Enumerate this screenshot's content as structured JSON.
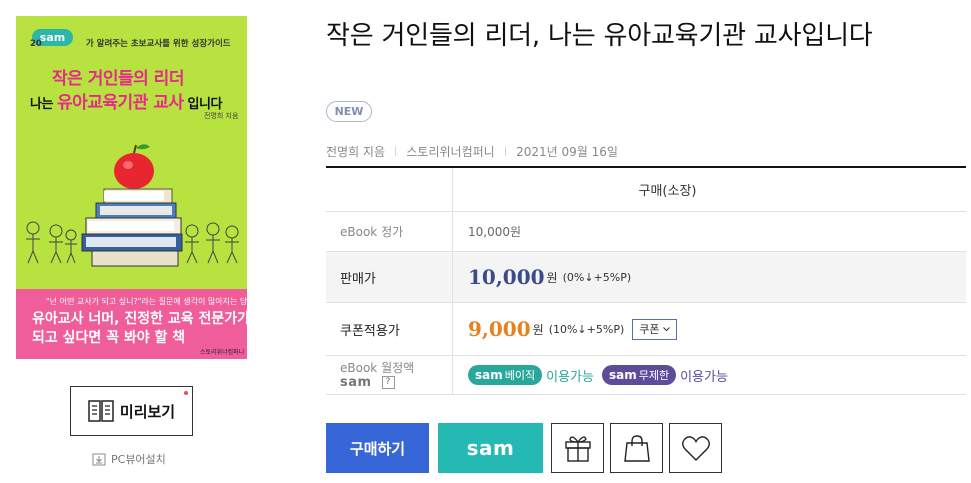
{
  "cover": {
    "sam_badge": "sam",
    "tagline": "가 알려주는 초보교사를 위한 성장가이드",
    "tagline_prefix": "20",
    "title_line1": "작은 거인들의 리더",
    "title_line2_a": "나는 ",
    "title_line2_b": "유아교육기관 교사",
    "title_line2_c": " 입니다",
    "author": "전명희 지음",
    "quote": "\"넌 어떤 교사가 되고 싶니?\"라는 질문에 생각이 많아지는 당신",
    "bottom_line1": "유아교사 너머, 진정한 교육 전문가가",
    "bottom_line2": "되고 싶다면 꼭 봐야 할 책",
    "publisher": "스토리위너컴퍼니"
  },
  "preview": {
    "label": "미리보기",
    "icon": "book-open-icon"
  },
  "pc_viewer": {
    "label": "PC뷰어설치",
    "icon": "download-icon"
  },
  "book": {
    "title": "작은 거인들의 리더, 나는 유아교육기관 교사입니다",
    "badge": "NEW",
    "author": "전명희 지음",
    "publisher": "스토리위너컴퍼니",
    "date": "2021년 09월 16일"
  },
  "price_table": {
    "header": "구매(소장)",
    "ebook_price_label": "eBook 정가",
    "ebook_price_value": "10,000원",
    "sale_label": "판매가",
    "sale_price": "10,000",
    "sale_won": "원",
    "sale_detail": "(0%↓+5%P)",
    "coupon_label": "쿠폰적용가",
    "coupon_price": "9,000",
    "coupon_won": "원",
    "coupon_detail": "(10%↓+5%P)",
    "coupon_button": "쿠폰",
    "sam_label": "eBook 월정액",
    "sam_logo": "sam",
    "sam_help": "?",
    "sam_basic_logo": "sam",
    "sam_basic": "베이직",
    "sam_basic_avail": "이용가능",
    "sam_unlimited_logo": "sam",
    "sam_unlimited": "무제한",
    "sam_unlimited_avail": "이용가능"
  },
  "actions": {
    "buy": "구매하기",
    "sam": "sam"
  },
  "colors": {
    "cover_bg": "#b7e23f",
    "cover_pink": "#ef5d9a",
    "buy": "#3766d9",
    "sam": "#24b9b3",
    "sale_price": "#3b4a8a",
    "coupon_price": "#e8811c"
  }
}
